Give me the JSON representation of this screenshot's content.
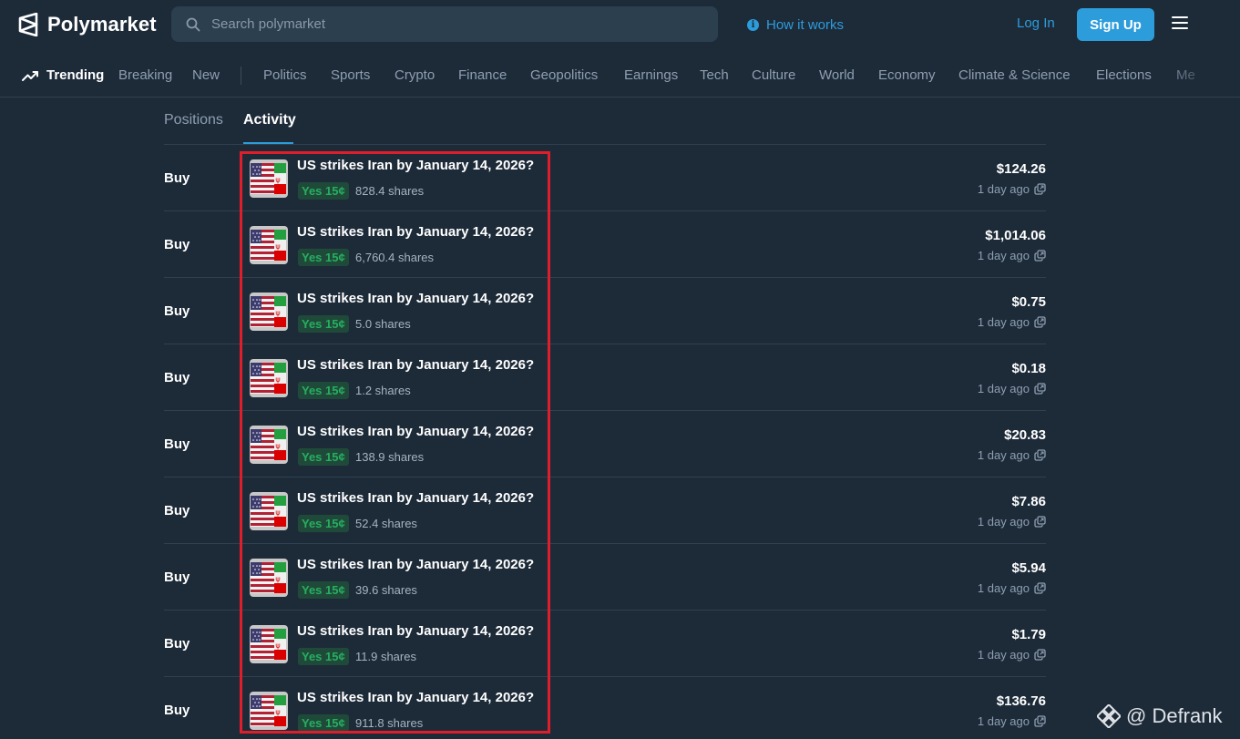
{
  "header": {
    "logo_text": "Polymarket",
    "search_placeholder": "Search polymarket",
    "how_it_works": "How it works",
    "login": "Log In",
    "signup": "Sign Up"
  },
  "nav": {
    "trending": "Trending",
    "breaking": "Breaking",
    "new": "New",
    "categories": [
      "Politics",
      "Sports",
      "Crypto",
      "Finance",
      "Geopolitics",
      "Earnings",
      "Tech",
      "Culture",
      "World",
      "Economy",
      "Climate & Science",
      "Elections",
      "Me"
    ]
  },
  "tabs": {
    "positions": "Positions",
    "activity": "Activity"
  },
  "activity": [
    {
      "type": "Buy",
      "market": "US strikes Iran by January 14, 2026?",
      "outcome": "Yes 15¢",
      "shares": "828.4 shares",
      "amount": "$124.26",
      "time": "1 day ago"
    },
    {
      "type": "Buy",
      "market": "US strikes Iran by January 14, 2026?",
      "outcome": "Yes 15¢",
      "shares": "6,760.4 shares",
      "amount": "$1,014.06",
      "time": "1 day ago"
    },
    {
      "type": "Buy",
      "market": "US strikes Iran by January 14, 2026?",
      "outcome": "Yes 15¢",
      "shares": "5.0 shares",
      "amount": "$0.75",
      "time": "1 day ago"
    },
    {
      "type": "Buy",
      "market": "US strikes Iran by January 14, 2026?",
      "outcome": "Yes 15¢",
      "shares": "1.2 shares",
      "amount": "$0.18",
      "time": "1 day ago"
    },
    {
      "type": "Buy",
      "market": "US strikes Iran by January 14, 2026?",
      "outcome": "Yes 15¢",
      "shares": "138.9 shares",
      "amount": "$20.83",
      "time": "1 day ago"
    },
    {
      "type": "Buy",
      "market": "US strikes Iran by January 14, 2026?",
      "outcome": "Yes 15¢",
      "shares": "52.4 shares",
      "amount": "$7.86",
      "time": "1 day ago"
    },
    {
      "type": "Buy",
      "market": "US strikes Iran by January 14, 2026?",
      "outcome": "Yes 15¢",
      "shares": "39.6 shares",
      "amount": "$5.94",
      "time": "1 day ago"
    },
    {
      "type": "Buy",
      "market": "US strikes Iran by January 14, 2026?",
      "outcome": "Yes 15¢",
      "shares": "11.9 shares",
      "amount": "$1.79",
      "time": "1 day ago"
    },
    {
      "type": "Buy",
      "market": "US strikes Iran by January 14, 2026?",
      "outcome": "Yes 15¢",
      "shares": "911.8 shares",
      "amount": "$136.76",
      "time": "1 day ago"
    }
  ],
  "watermark": {
    "text": "@ Defrank"
  },
  "colors": {
    "background": "#1d2b39",
    "accent": "#2d9cdb",
    "yes_green": "#27ae60",
    "highlight_red": "#e01e2b"
  }
}
